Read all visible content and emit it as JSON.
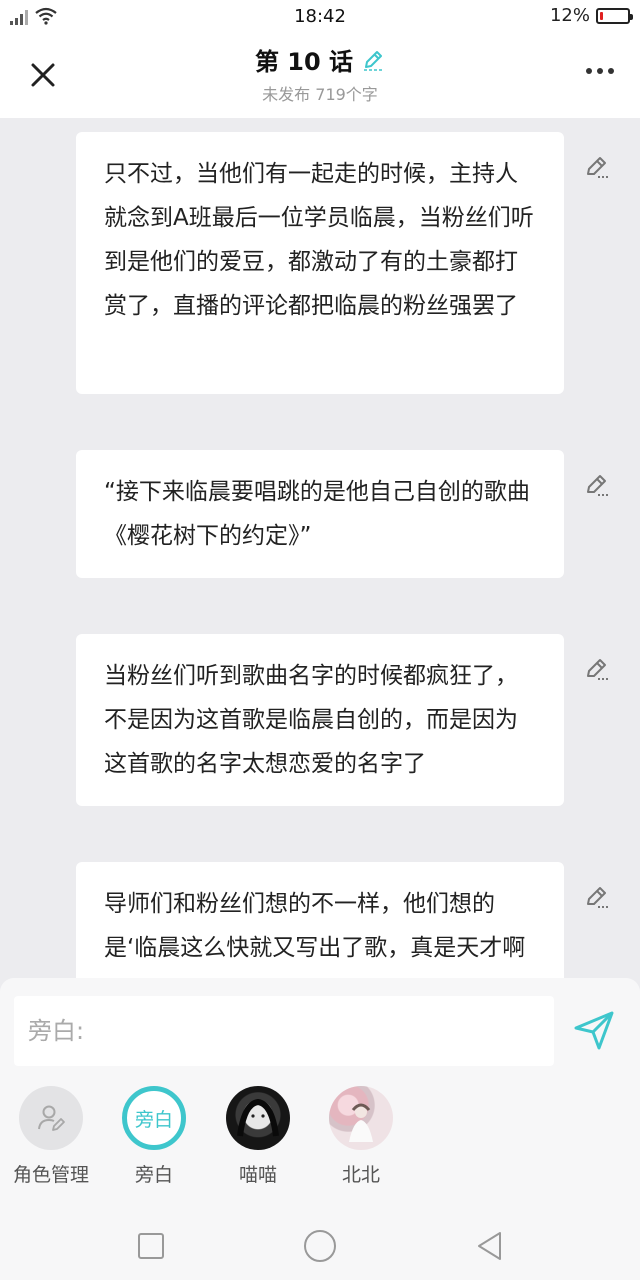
{
  "status_bar": {
    "time": "18:42",
    "battery": "12%",
    "battery_level": 0.12,
    "battery_color": "#e02020"
  },
  "header": {
    "title": "第 10 话",
    "subtitle": "未发布 719个字"
  },
  "paragraphs": [
    "只不过，当他们有一起走的时候，主持人就念到A班最后一位学员临晨，当粉丝们听到是他们的爱豆，都激动了有的土豪都打赏了，直播的评论都把临晨的粉丝强罢了",
    "“接下来临晨要唱跳的是他自己自创的歌曲《樱花树下的约定》”",
    "当粉丝们听到歌曲名字的时候都疯狂了，不是因为这首歌是临晨自创的，而是因为这首歌的名字太想恋爱的名字了",
    "导师们和粉丝们想的不一样，他们想的是‘临晨这么快就又写出了歌，真是天才啊他说是吧都激动了"
  ],
  "composer": {
    "placeholder": "旁白:",
    "accent_color": "#3ec6cc"
  },
  "roles": [
    {
      "label": "角色管理",
      "icon": "person-edit-icon"
    },
    {
      "label": "旁白",
      "avatar_text": "旁白",
      "selected": true
    },
    {
      "label": "喵喵",
      "avatar": "girl-dark-avatar"
    },
    {
      "label": "北北",
      "avatar": "girl-blossom-avatar"
    }
  ],
  "nav": {
    "icons": [
      "square-icon",
      "circle-icon",
      "back-triangle-icon"
    ]
  }
}
